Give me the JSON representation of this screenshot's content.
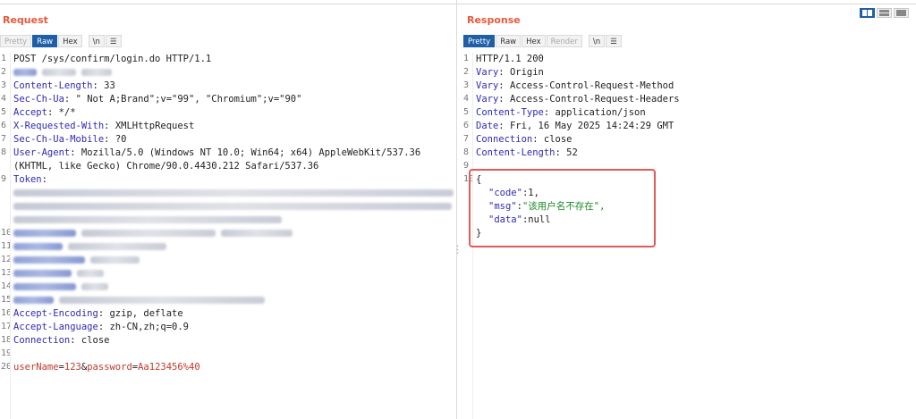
{
  "request": {
    "title": "Request",
    "tabs": [
      {
        "label": "Pretty",
        "state": "dim"
      },
      {
        "label": "Raw",
        "state": "active"
      },
      {
        "label": "Hex",
        "state": ""
      },
      {
        "label": "\\n",
        "state": "gap"
      },
      {
        "label": "☰",
        "state": ""
      }
    ],
    "lines": [
      {
        "num": "1",
        "text": "POST /sys/confirm/login.do HTTP/1.1"
      },
      {
        "num": "2",
        "key": "",
        "value": ""
      },
      {
        "num": "3",
        "key": "Content-Length",
        "value": "33"
      },
      {
        "num": "4",
        "key": "Sec-Ch-Ua",
        "value": "\" Not A;Brand\";v=\"99\", \"Chromium\";v=\"90\""
      },
      {
        "num": "5",
        "key": "Accept",
        "value": "*/*"
      },
      {
        "num": "6",
        "key": "X-Requested-With",
        "value": "XMLHttpRequest"
      },
      {
        "num": "7",
        "key": "Sec-Ch-Ua-Mobile",
        "value": "?0"
      },
      {
        "num": "8",
        "key": "User-Agent",
        "value": "Mozilla/5.0 (Windows NT 10.0; Win64; x64) AppleWebKit/537.36"
      },
      {
        "num": "",
        "text": "(KHTML, like Gecko) Chrome/90.0.4430.212 Safari/537.36"
      },
      {
        "num": "9",
        "key": "Token",
        "value": ""
      },
      {
        "num": "10",
        "key": "",
        "value": ""
      },
      {
        "num": "11",
        "key": "",
        "value": ""
      },
      {
        "num": "12",
        "key": "",
        "value": ""
      },
      {
        "num": "13",
        "key": "",
        "value": ""
      },
      {
        "num": "14",
        "key": "",
        "value": ""
      },
      {
        "num": "15",
        "key": "",
        "value": ""
      },
      {
        "num": "16",
        "key": "Accept-Encoding",
        "value": "gzip, deflate"
      },
      {
        "num": "17",
        "key": "Accept-Language",
        "value": "zh-CN,zh;q=0.9"
      },
      {
        "num": "18",
        "key": "Connection",
        "value": "close"
      },
      {
        "num": "19",
        "text": ""
      },
      {
        "num": "20",
        "body": {
          "p1": "userName",
          "eq1": "=",
          "v1": "123",
          "amp": "&",
          "p2": "password",
          "eq2": "=",
          "v2": "Aa123456%40"
        }
      }
    ]
  },
  "response": {
    "title": "Response",
    "tabs": [
      {
        "label": "Pretty",
        "state": "active"
      },
      {
        "label": "Raw",
        "state": ""
      },
      {
        "label": "Hex",
        "state": ""
      },
      {
        "label": "Render",
        "state": "dim"
      },
      {
        "label": "\\n",
        "state": "gap"
      },
      {
        "label": "☰",
        "state": ""
      }
    ],
    "lines": [
      {
        "num": "1",
        "text": "HTTP/1.1 200"
      },
      {
        "num": "2",
        "key": "Vary",
        "value": "Origin"
      },
      {
        "num": "3",
        "key": "Vary",
        "value": "Access-Control-Request-Method"
      },
      {
        "num": "4",
        "key": "Vary",
        "value": "Access-Control-Request-Headers"
      },
      {
        "num": "5",
        "key": "Content-Type",
        "value": "application/json"
      },
      {
        "num": "6",
        "key": "Date",
        "value": "Fri, 16 May 2025 14:24:29 GMT"
      },
      {
        "num": "7",
        "key": "Connection",
        "value": "close"
      },
      {
        "num": "8",
        "key": "Content-Length",
        "value": "52"
      },
      {
        "num": "9",
        "text": ""
      },
      {
        "num": "10",
        "text": "{"
      },
      {
        "num": "",
        "json": {
          "k": "\"code\"",
          "sep": ":",
          "v": "1,",
          "vtype": "plain"
        }
      },
      {
        "num": "",
        "json": {
          "k": "\"msg\"",
          "sep": ":",
          "v": "\"该用户名不存在\",",
          "vtype": "str"
        }
      },
      {
        "num": "",
        "json": {
          "k": "\"data\"",
          "sep": ":",
          "v": "null",
          "vtype": "plain"
        }
      },
      {
        "num": "",
        "text": "}"
      }
    ]
  },
  "colors": {
    "title": "#e8593b",
    "active_tab": "#1f5fa8",
    "header_key": "#2e2ab3",
    "body_param": "#c0392b",
    "json_string": "#1d8a27",
    "highlight": "#e05a5a"
  },
  "icons": [
    "layout-side-by-side-icon",
    "layout-top-bottom-icon",
    "layout-single-icon",
    "menu-icon"
  ]
}
